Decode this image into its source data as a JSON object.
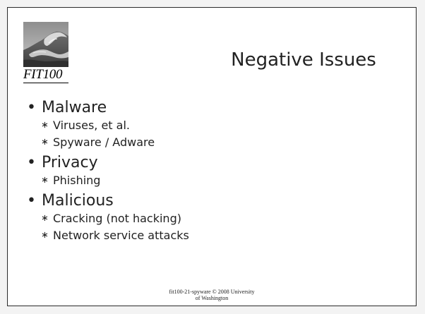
{
  "slide": {
    "logo_text": "FIT100",
    "title": "Negative Issues",
    "bullet_symbol": "•",
    "sub_bullet_symbol": "∗",
    "sections": [
      {
        "heading": "Malware",
        "items": [
          "Viruses, et al.",
          "Spyware / Adware"
        ]
      },
      {
        "heading": "Privacy",
        "items": [
          "Phishing"
        ]
      },
      {
        "heading": "Malicious",
        "items": [
          "Cracking (not hacking)",
          "Network service attacks"
        ]
      }
    ],
    "footer_line1": "fit100-21-spyware © 2008 University",
    "footer_line2": "of Washington"
  }
}
